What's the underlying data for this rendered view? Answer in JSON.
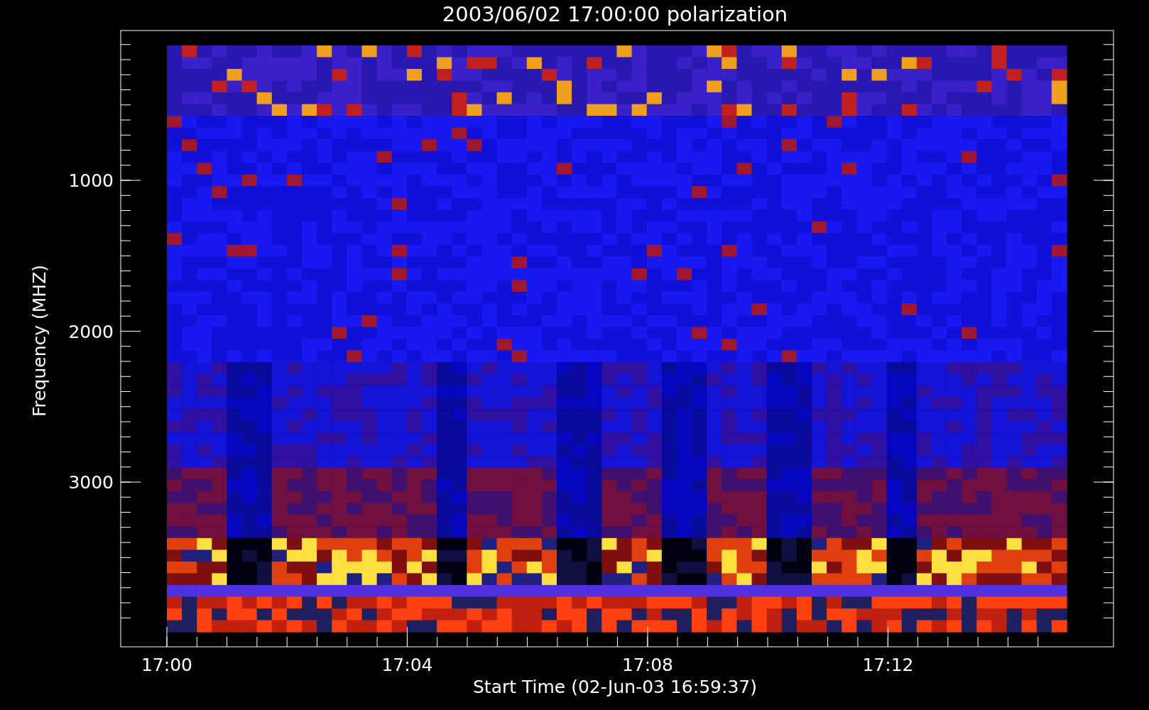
{
  "plot": {
    "title": "2003/06/02 17:00:00 polarization",
    "y_axis": {
      "label": "Frequency (MHZ)",
      "ticks": [
        "1000",
        "2000",
        "3000"
      ]
    },
    "x_axis": {
      "label": "Start Time (02-Jun-03 16:59:37)",
      "ticks": [
        "17:00",
        "17:04",
        "17:08",
        "17:12"
      ]
    }
  }
}
